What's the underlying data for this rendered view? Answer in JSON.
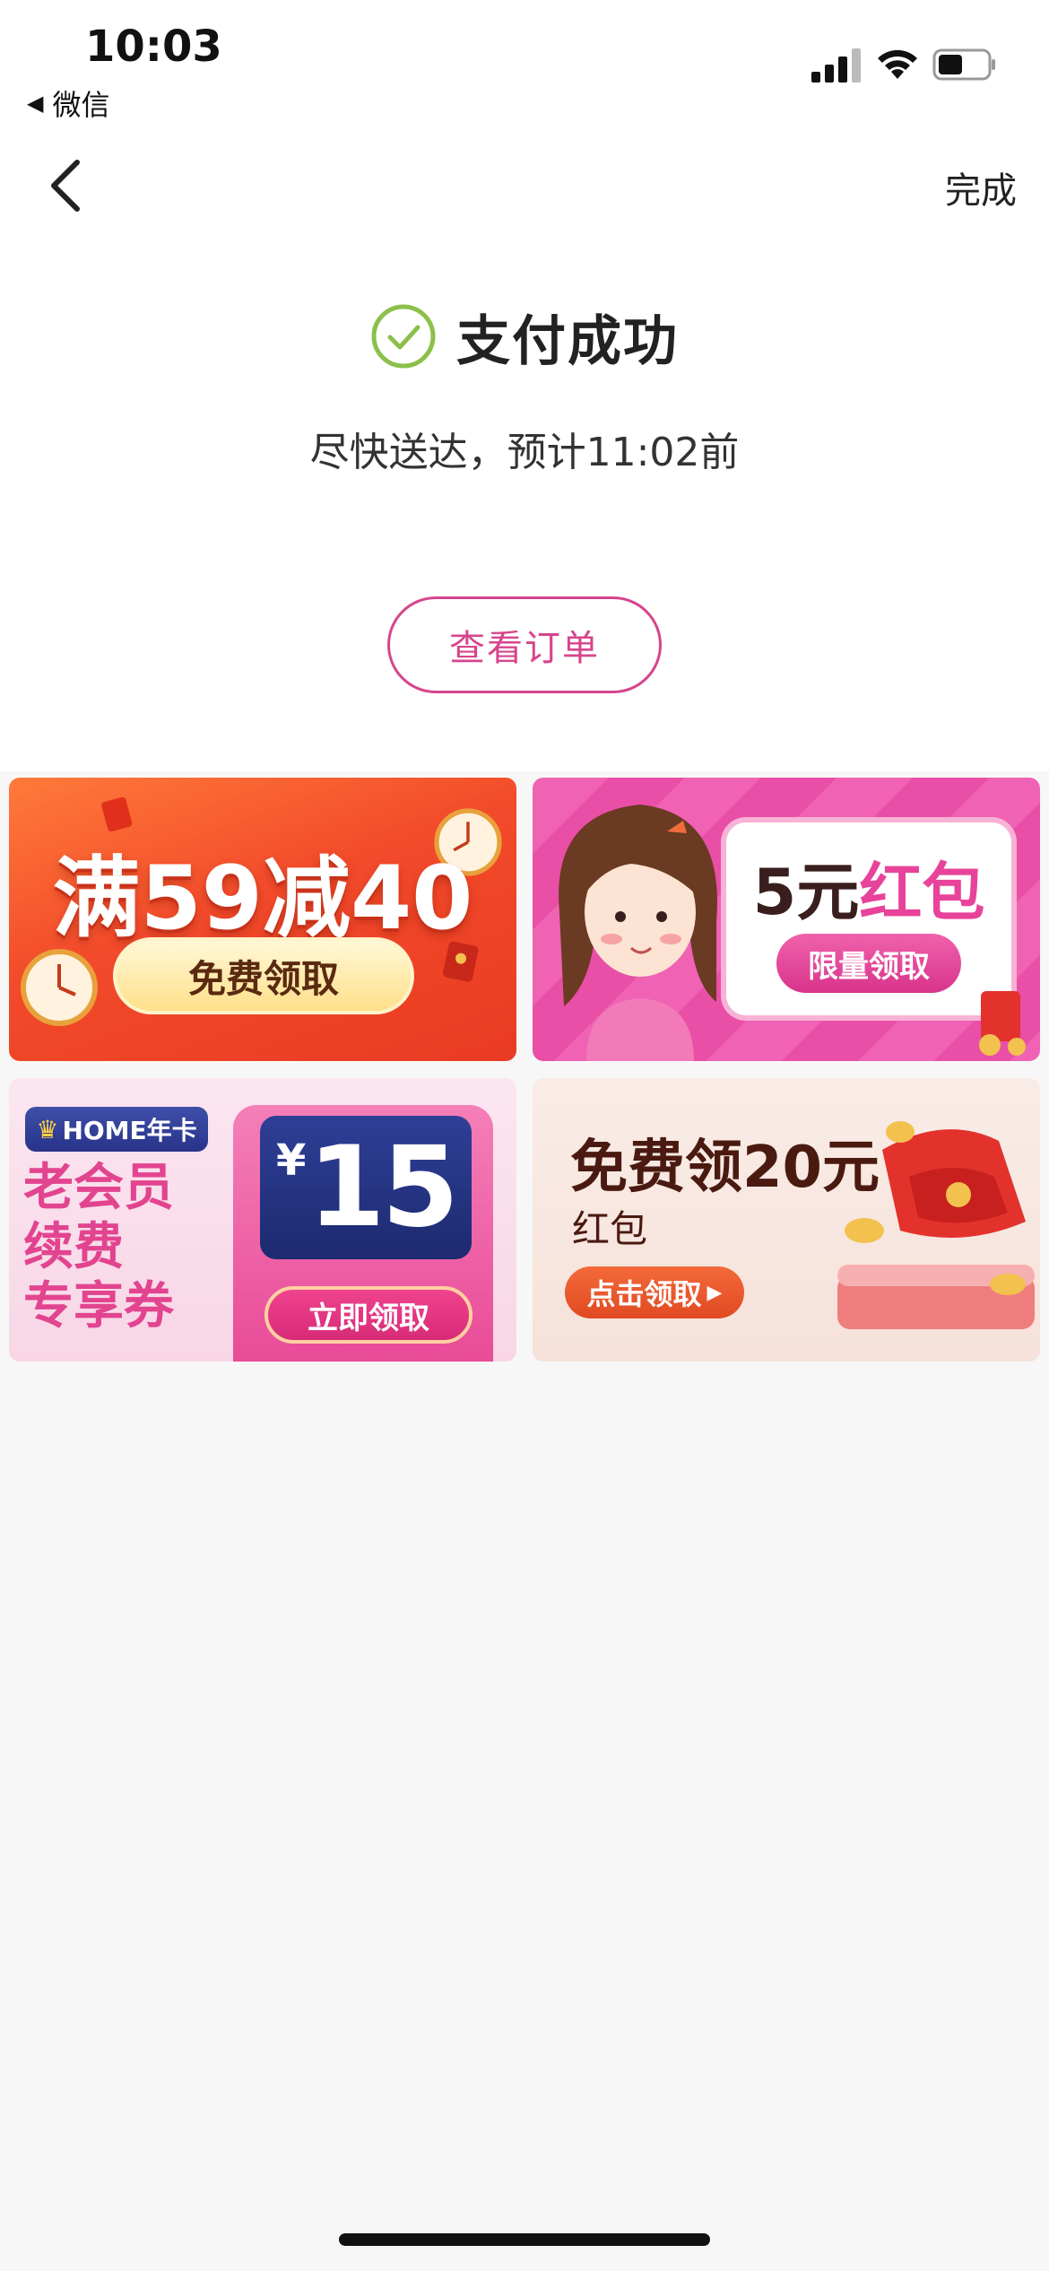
{
  "status_bar": {
    "time": "10:03",
    "back_app": "微信",
    "icons": [
      "signal-icon",
      "wifi-icon",
      "battery-icon"
    ]
  },
  "nav": {
    "back_icon": "chevron-left-icon",
    "done_label": "完成"
  },
  "result": {
    "icon": "check-circle-icon",
    "title": "支付成功",
    "eta_text": "尽快送达，预计11:02前",
    "view_order_label": "查看订单"
  },
  "banners": [
    {
      "title": "满59减40",
      "button_label": "免费领取",
      "colors": {
        "background": "#f24a2a",
        "button": "#ffe08a"
      }
    },
    {
      "title_part1": "5元",
      "title_part2": "红包",
      "button_label": "限量领取",
      "colors": {
        "background": "#f062b3",
        "accent": "#e8439a"
      }
    },
    {
      "badge": "HOME年卡",
      "badge_icon": "crown-icon",
      "line1": "老会员",
      "line2": "续费",
      "line3": "专享券",
      "currency": "¥",
      "amount": "15",
      "button_label": "立即领取",
      "colors": {
        "accent": "#e2448f",
        "card": "#2e3f96"
      }
    },
    {
      "title": "免费领20元",
      "subtitle": "红包",
      "button_label": "点击领取",
      "button_icon": "caret-right-icon",
      "colors": {
        "background": "#f9ece6",
        "button": "#e14a22"
      }
    }
  ],
  "colors": {
    "primary_pink": "#d6458c",
    "success_green": "#8cc04b",
    "page_background": "#f7f7f7"
  }
}
